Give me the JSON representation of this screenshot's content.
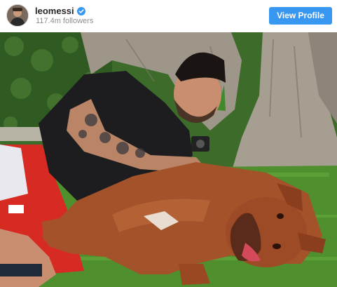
{
  "profile": {
    "username": "leomessi",
    "followers": "117.4m followers",
    "verified": true,
    "avatar_icon": "profile-avatar-icon"
  },
  "actions": {
    "view_profile_label": "View Profile",
    "button_color": "#3897f0"
  },
  "post": {
    "image_icon": "post-photo"
  }
}
